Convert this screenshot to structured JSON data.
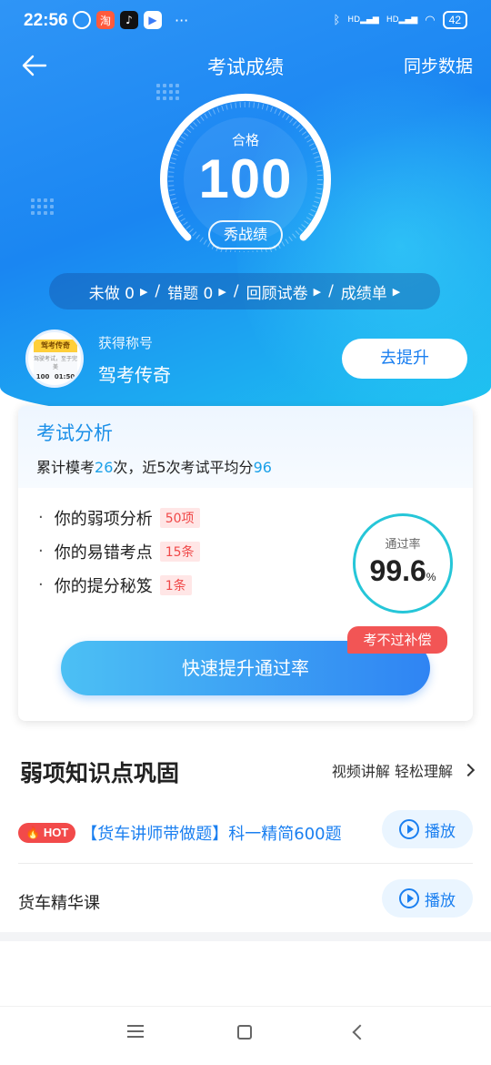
{
  "status_bar": {
    "time": "22:56",
    "battery": "42",
    "more": "···",
    "hd1": "HD",
    "hd2": "HD"
  },
  "header": {
    "title": "考试成绩",
    "sync_label": "同步数据"
  },
  "score": {
    "status": "合格",
    "value": "100",
    "show_label": "秀战绩",
    "gauge_fraction": 1.0
  },
  "quick_links": [
    {
      "label": "未做 0"
    },
    {
      "label": "错题  0"
    },
    {
      "label": "回顾试卷"
    },
    {
      "label": "成绩单"
    }
  ],
  "title_award": {
    "label": "获得称号",
    "value": "驾考传奇",
    "button": "去提升",
    "badge_title": "驾考传奇",
    "badge_line": "驾驶考试，至于完美",
    "badge_score": "100",
    "badge_time": "01:50"
  },
  "analysis": {
    "title": "考试分析",
    "summary_prefix": "累计模考",
    "attempts": "26",
    "summary_mid": "次，近5次考试平均分",
    "avg_score": "96",
    "items": [
      {
        "label": "你的弱项分析",
        "tag": "50项"
      },
      {
        "label": "你的易错考点",
        "tag": "15条"
      },
      {
        "label": "你的提分秘笈",
        "tag": "1条"
      }
    ],
    "pass_rate_label": "通过率",
    "pass_rate": "99.6",
    "pass_rate_unit": "%",
    "boost_button": "快速提升通过率",
    "compensation_tag": "考不过补偿"
  },
  "weak_points": {
    "title": "弱项知识点巩固",
    "more_label": "视频讲解 轻松理解",
    "courses": [
      {
        "hot": "HOT",
        "name": "【货车讲师带做题】科一精简600题",
        "play": "播放"
      },
      {
        "name": "货车精华课",
        "play": "播放"
      }
    ]
  },
  "colors": {
    "primary": "#1a86f2",
    "accent_cyan": "#26c6d8",
    "danger": "#f24a4a"
  }
}
